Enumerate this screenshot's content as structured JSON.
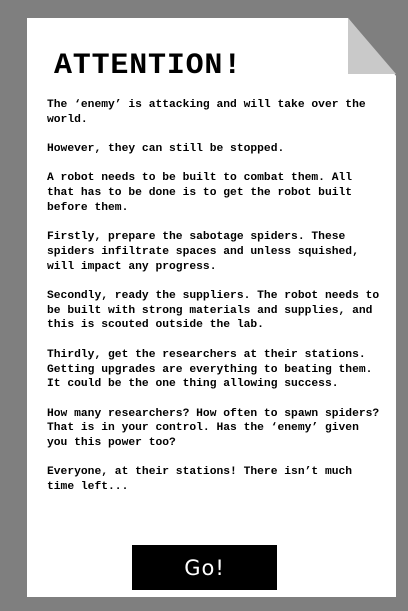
{
  "title": "ATTENTION!",
  "paragraphs": [
    "The ‘enemy’ is attacking and will take over the world.",
    "However, they can still be stopped.",
    "A robot needs to be built to combat them. All that has to be done is to get the robot built before them.",
    "Firstly, prepare the sabotage spiders. These spiders infiltrate spaces and unless squished, will impact any progress.",
    "Secondly, ready the suppliers. The robot needs to be built with strong materials and supplies, and this is scouted outside the lab.",
    "Thirdly, get the researchers at their stations. Getting upgrades are everything to beating them. It could be the one thing allowing success.",
    "How many researchers? How often to spawn spiders? That is in your control. Has the ‘enemy’ given you this power too?",
    "Everyone, at their stations! There isn’t much time left..."
  ],
  "go_button_label": "Go!",
  "colors": {
    "background": "#7f7f7f",
    "paper": "#ffffff",
    "fold": "#c9c9c9",
    "button": "#000000",
    "button_text": "#ffffff"
  }
}
